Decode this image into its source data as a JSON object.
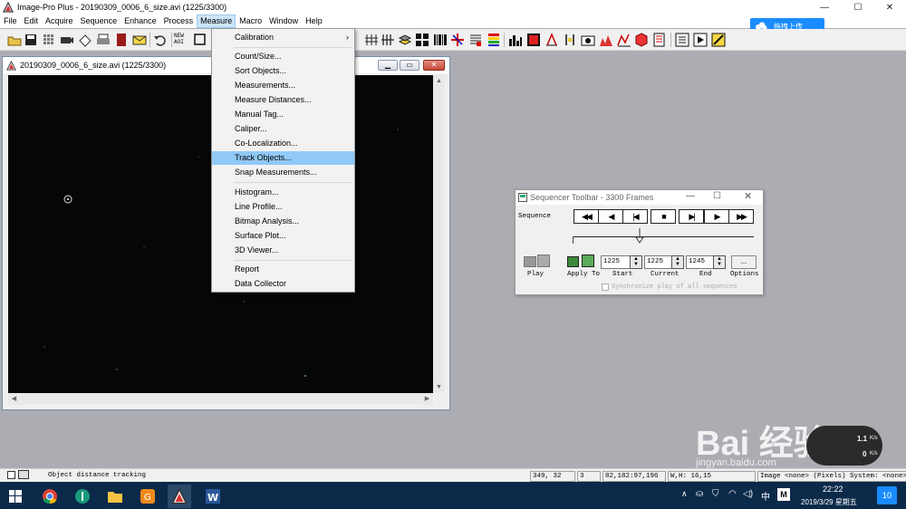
{
  "app": {
    "title": "Image-Pro Plus - 20190309_0006_6_size.avi (1225/3300)",
    "window_controls": {
      "minimize": "—",
      "maximize": "☐",
      "close": "✕"
    }
  },
  "menubar": {
    "items": [
      "File",
      "Edit",
      "Acquire",
      "Sequence",
      "Enhance",
      "Process",
      "Measure",
      "Macro",
      "Window",
      "Help"
    ],
    "active": "Measure"
  },
  "upload_button": {
    "label": "拖拽上传",
    "icon": "cloud-icon"
  },
  "toolbar": {
    "new_aoi_label_line1": "NEW",
    "new_aoi_label_line2": "AOI"
  },
  "image_window": {
    "title": "20190309_0006_6_size.avi (1225/3300)"
  },
  "measure_menu": {
    "items": [
      {
        "label": "Calibration",
        "submenu": true
      },
      {
        "label": "Count/Size..."
      },
      {
        "label": "Sort Objects..."
      },
      {
        "label": "Measurements..."
      },
      {
        "label": "Measure Distances..."
      },
      {
        "label": "Manual Tag..."
      },
      {
        "label": "Caliper..."
      },
      {
        "label": "Co-Localization..."
      },
      {
        "label": "Track Objects...",
        "highlighted": true
      },
      {
        "label": "Snap Measurements..."
      },
      {
        "label": "Histogram..."
      },
      {
        "label": "Line Profile..."
      },
      {
        "label": "Bitmap Analysis..."
      },
      {
        "label": "Surface Plot..."
      },
      {
        "label": "3D Viewer..."
      },
      {
        "label": "Report"
      },
      {
        "label": "Data Collector"
      }
    ]
  },
  "sequencer": {
    "title": "Sequencer Toolbar - 3300 Frames",
    "sequence_label": "Sequence",
    "play_label": "Play",
    "apply_to_label": "Apply To",
    "start_label": "Start",
    "current_label": "Current",
    "end_label": "End",
    "options_label": "Options",
    "options_button": "...",
    "start_value": "1225",
    "current_value": "1225",
    "end_value": "1245",
    "slider_position": 0.371,
    "sync_label": "Synchronize play of all sequences",
    "sync_checked": false
  },
  "statusbar": {
    "message": "Object distance tracking",
    "coords": "349,  32",
    "value": "3",
    "rgb": "82,182:97,196",
    "wh": "W,H: 16,15",
    "info": "Image  <none>  (Pixels) System: <none>"
  },
  "taskbar": {
    "clock_time": "22:22",
    "clock_date": "2019/3/29 星期五",
    "ime": "中",
    "notification_count": "10"
  },
  "watermark": {
    "text": "Bai 经验",
    "sub": "jingyan.baidu.com"
  },
  "net_gauge": {
    "up": "1.1",
    "up_unit": "K/s",
    "down": "0",
    "down_unit": "K/s"
  }
}
